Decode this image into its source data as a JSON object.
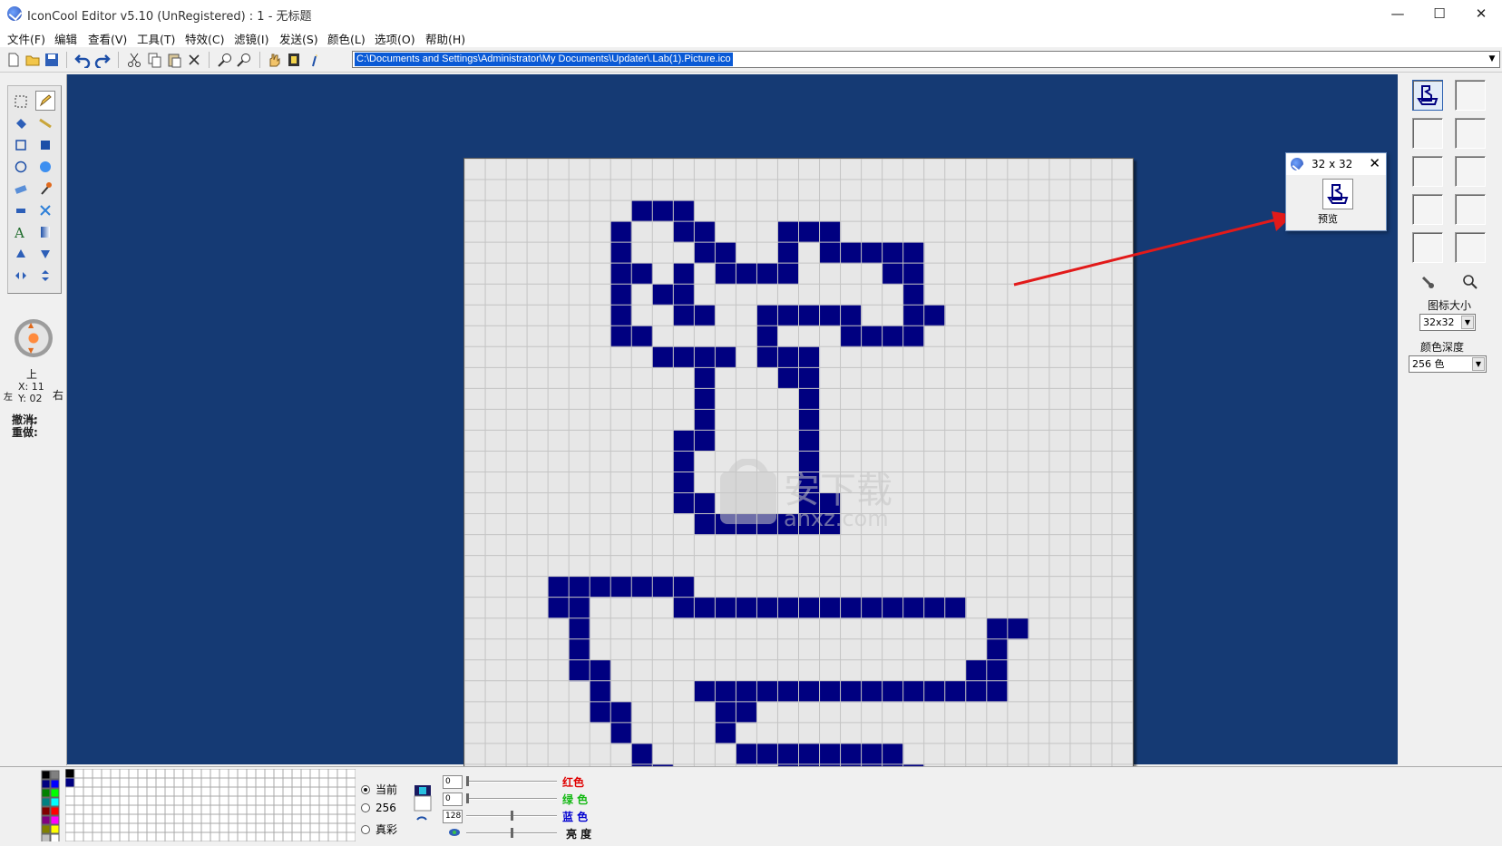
{
  "window": {
    "title": "IconCool Editor v5.10 (UnRegistered) : 1 - 无标题",
    "min_glyph": "—",
    "max_glyph": "☐",
    "close_glyph": "✕"
  },
  "menu": [
    "文件(F)",
    "编辑",
    "查看(V)",
    "工具(T)",
    "特效(C)",
    "滤镜(I)",
    "发送(S)",
    "颜色(L)",
    "选项(O)",
    "帮助(H)"
  ],
  "path": "C:\\Documents and Settings\\Administrator\\My Documents\\Updater\\.Lab(1).Picture.ico",
  "nav": {
    "up": "上",
    "down": "下",
    "left": "左",
    "right": "右"
  },
  "coords": {
    "x": "X: 11",
    "y": "Y: 02"
  },
  "history": {
    "undo": "撤消:",
    "redo": "重做:"
  },
  "right_panel": {
    "icon_size_label": "图标大小",
    "icon_size_value": "32x32",
    "color_depth_label": "颜色深度",
    "color_depth_value": "256 色"
  },
  "preview": {
    "title": "32 x 32",
    "label": "预览",
    "close_glyph": "✕"
  },
  "bottom": {
    "mode_options": [
      "当前",
      "256",
      "真彩"
    ],
    "mode_selected": 0,
    "sliders": [
      {
        "value": "0",
        "label": "红色",
        "color": "#e00000",
        "level": 0.0
      },
      {
        "value": "0",
        "label": "绿 色",
        "color": "#12b812",
        "level": 0.0
      },
      {
        "value": "128",
        "label": "蓝 色",
        "color": "#0000d0",
        "level": 0.5
      },
      {
        "value": "",
        "label": "亮   度",
        "color": "#111111",
        "level": 0.5
      }
    ]
  },
  "watermark": {
    "text": "安下载",
    "subtext": "anxz.com"
  },
  "colors": {
    "workspace_bg": "#153a74",
    "pixel_color": "#000080",
    "canvas_bg": "#e7e7e7",
    "arrow": "#e21a1a",
    "selection_blue": "#0a5ad6"
  },
  "pixel_art": {
    "grid": "32x32",
    "rows": [
      "................................",
      "................................",
      "........###.....................",
      ".......#..##...###..............",
      ".......#...##..#.#####..........",
      ".......##.#.####....##..........",
      ".......#.##..........#..........",
      ".......#..##..#####..##.........",
      ".......##.....#...####..........",
      ".........####.###...............",
      "...........#...##...............",
      "...........#....#...............",
      "...........#....#...............",
      "..........##....#...............",
      "..........#.....#...............",
      "..........#.....#...............",
      "..........##....##..............",
      "...........#######..............",
      "................................",
      "................................",
      "....#######.....................",
      "....##....##############........",
      ".....#...................##.....",
      ".....#...................#......",
      ".....##.................##......",
      "......#....###############......",
      "......##....##..................",
      ".......#....#...................",
      "........#....########...........",
      "........##.....#######..........",
      ".........######.................",
      "................................"
    ]
  }
}
